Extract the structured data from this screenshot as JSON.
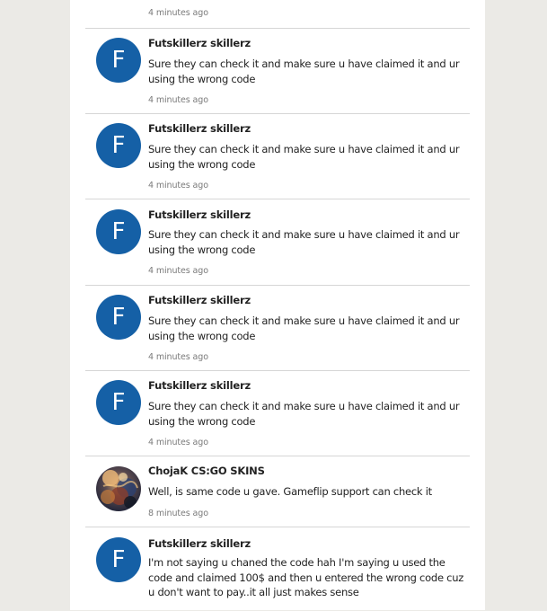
{
  "top_timestamp": "4 minutes ago",
  "comments": [
    {
      "author": "Futskillerz skillerz",
      "avatar_letter": "F",
      "text": "Sure they can check it and make sure u have claimed it and ur using the wrong code",
      "time": "4 minutes ago"
    },
    {
      "author": "Futskillerz skillerz",
      "avatar_letter": "F",
      "text": "Sure they can check it and make sure u have claimed it and ur using the wrong code",
      "time": "4 minutes ago"
    },
    {
      "author": "Futskillerz skillerz",
      "avatar_letter": "F",
      "text": "Sure they can check it and make sure u have claimed it and ur using the wrong code",
      "time": "4 minutes ago"
    },
    {
      "author": "Futskillerz skillerz",
      "avatar_letter": "F",
      "text": "Sure they can check it and make sure u have claimed it and ur using the wrong code",
      "time": "4 minutes ago"
    },
    {
      "author": "Futskillerz skillerz",
      "avatar_letter": "F",
      "text": "Sure they can check it and make sure u have claimed it and ur using the wrong code",
      "time": "4 minutes ago"
    },
    {
      "author": "ChojaK CS:GO SKINS",
      "avatar_letter": "",
      "text": "Well, is same code u gave. Gameflip support can check it",
      "time": "8 minutes ago"
    },
    {
      "author": "Futskillerz skillerz",
      "avatar_letter": "F",
      "text": "I'm not saying u chaned the code hah I'm saying u used the code and claimed 100$ and then u entered the wrong code cuz u don't want to pay..it all just makes sense",
      "time": ""
    }
  ],
  "colors": {
    "avatar_blue": "#1560a6",
    "page_background": "#ebeae6"
  }
}
